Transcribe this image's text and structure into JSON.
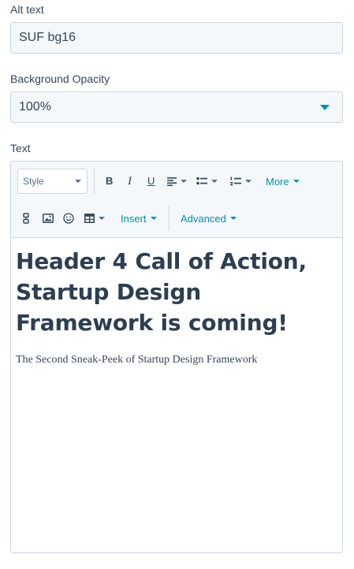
{
  "alt_text": {
    "label": "Alt text",
    "value": "SUF bg16"
  },
  "background_opacity": {
    "label": "Background Opacity",
    "selected": "100%"
  },
  "text": {
    "label": "Text",
    "toolbar": {
      "style_label": "Style",
      "bold_glyph": "B",
      "italic_glyph": "I",
      "underline_glyph": "U",
      "more_label": "More",
      "insert_label": "Insert",
      "advanced_label": "Advanced"
    },
    "heading": "Header 4 Call of Action, Startup Design Framework is coming!",
    "paragraph": "The Second Sneak-Peek of Startup Design Framework"
  },
  "colors": {
    "accent": "#0091ae",
    "text": "#33475b",
    "field_bg": "#f5f8fa",
    "border": "#cbd6e2"
  }
}
